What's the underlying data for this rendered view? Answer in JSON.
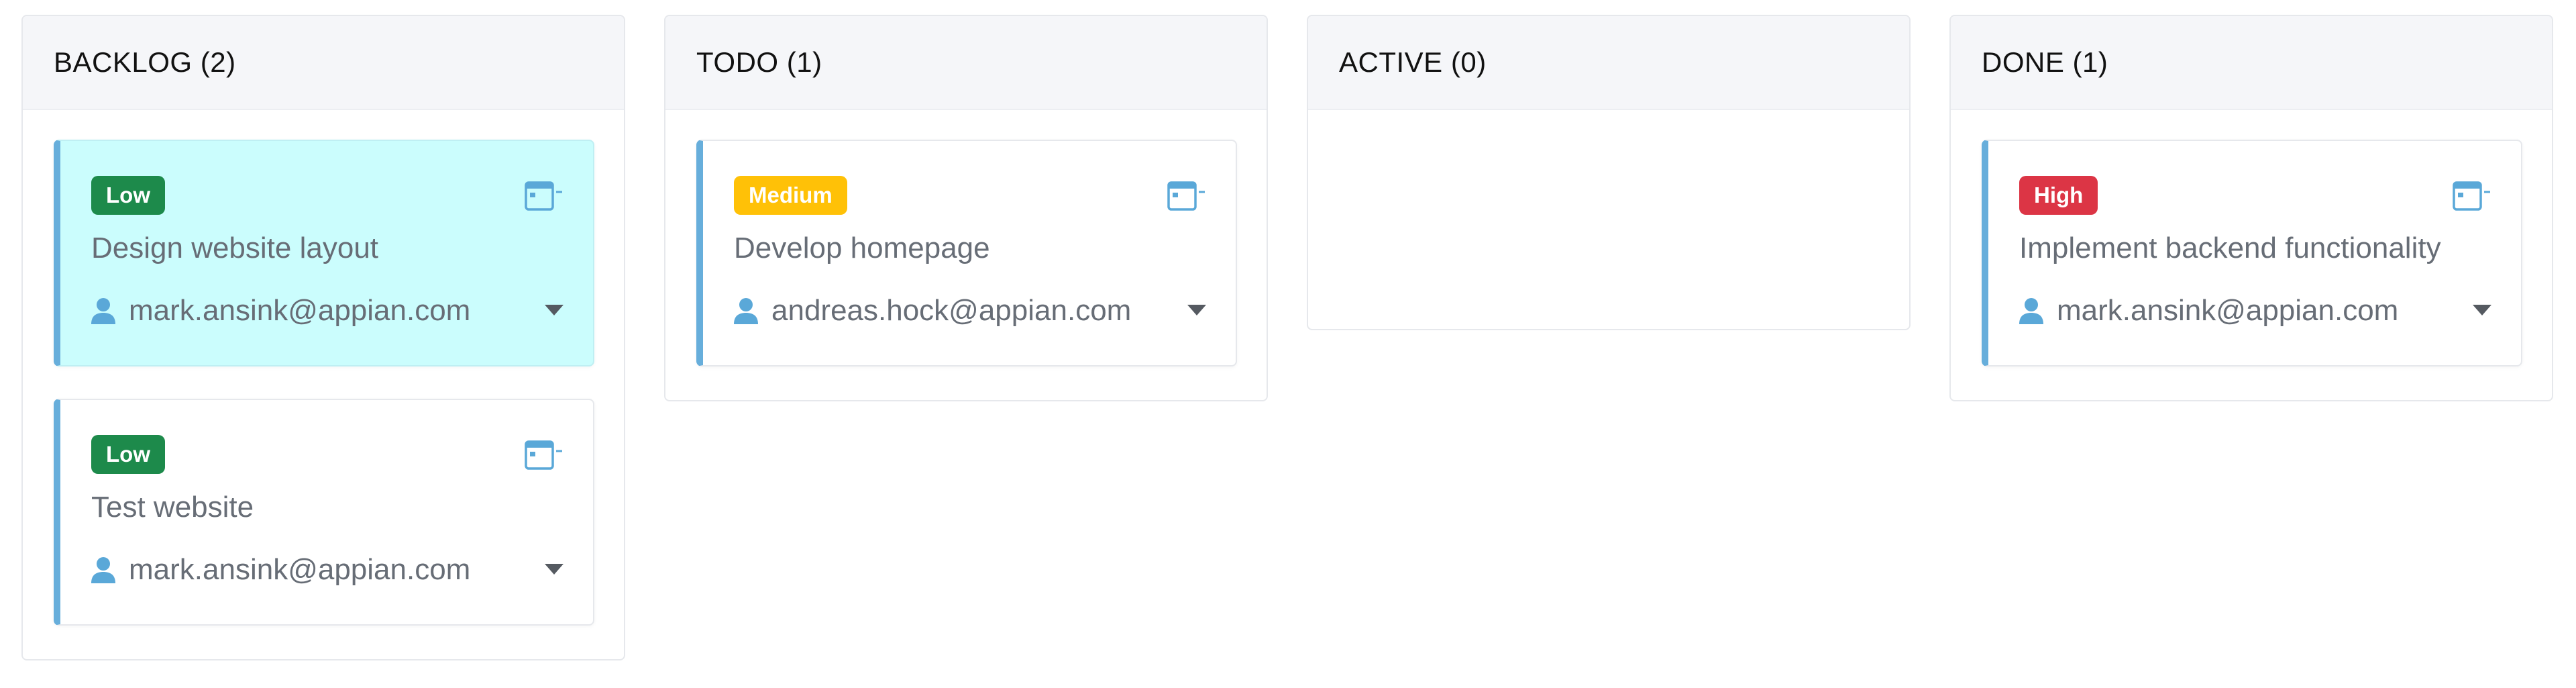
{
  "columns": {
    "backlog": {
      "title": "BACKLOG (2)",
      "cards": [
        {
          "priority": "Low",
          "title": "Design website layout",
          "assignee": "mark.ansink@appian.com",
          "selected": true
        },
        {
          "priority": "Low",
          "title": "Test website",
          "assignee": "mark.ansink@appian.com",
          "selected": false
        }
      ]
    },
    "todo": {
      "title": "TODO (1)",
      "cards": [
        {
          "priority": "Medium",
          "title": "Develop homepage",
          "assignee": "andreas.hock@appian.com",
          "selected": false
        }
      ]
    },
    "active": {
      "title": "ACTIVE (0)",
      "cards": []
    },
    "done": {
      "title": "DONE (1)",
      "cards": [
        {
          "priority": "High",
          "title": "Implement backend functionality",
          "assignee": "mark.ansink@appian.com",
          "selected": false
        }
      ]
    }
  },
  "colors": {
    "card_accent": "#67aedb",
    "selected_card_bg": "#cbfdfd",
    "priority_low": "#1d8a4b",
    "priority_medium": "#ffc107",
    "priority_high": "#dc3545",
    "icon_blue": "#5aa8d8"
  },
  "icons": {
    "date": "calendar-icon",
    "assignee": "user-icon",
    "menu": "caret-down-icon"
  }
}
